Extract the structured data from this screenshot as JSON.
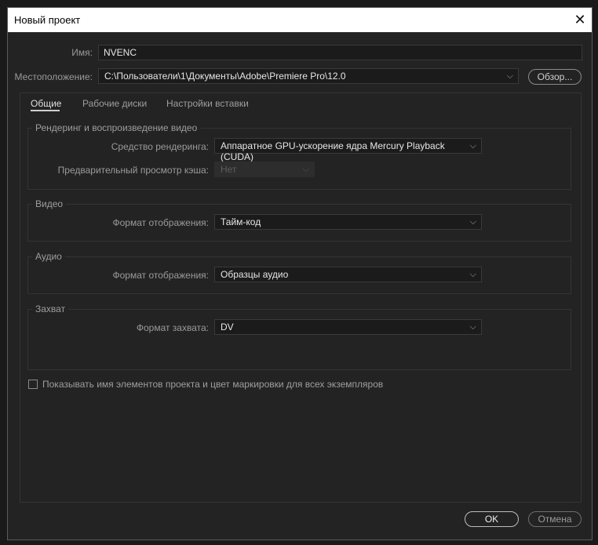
{
  "window": {
    "title": "Новый проект"
  },
  "name_field": {
    "label": "Имя:",
    "value": "NVENC"
  },
  "location_field": {
    "label": "Местоположение:",
    "value": "C:\\Пользователи\\1\\Документы\\Adobe\\Premiere Pro\\12.0",
    "browse_label": "Обзор..."
  },
  "tabs": [
    {
      "label": "Общие",
      "active": true
    },
    {
      "label": "Рабочие диски",
      "active": false
    },
    {
      "label": "Настройки вставки",
      "active": false
    }
  ],
  "render_group": {
    "title": "Рендеринг и воспроизведение видео",
    "renderer_label": "Средство рендеринга:",
    "renderer_value": "Аппаратное GPU-ускорение ядра Mercury Playback (CUDA)",
    "preview_cache_label": "Предварительный просмотр кэша:",
    "preview_cache_value": "Нет"
  },
  "video_group": {
    "title": "Видео",
    "display_format_label": "Формат отображения:",
    "display_format_value": "Тайм-код"
  },
  "audio_group": {
    "title": "Аудио",
    "display_format_label": "Формат отображения:",
    "display_format_value": "Образцы аудио"
  },
  "capture_group": {
    "title": "Захват",
    "capture_format_label": "Формат захвата:",
    "capture_format_value": "DV"
  },
  "show_names_checkbox": {
    "label": "Показывать имя элементов проекта и цвет маркировки для всех экземпляров",
    "checked": false
  },
  "buttons": {
    "ok": "OK",
    "cancel": "Отмена"
  }
}
